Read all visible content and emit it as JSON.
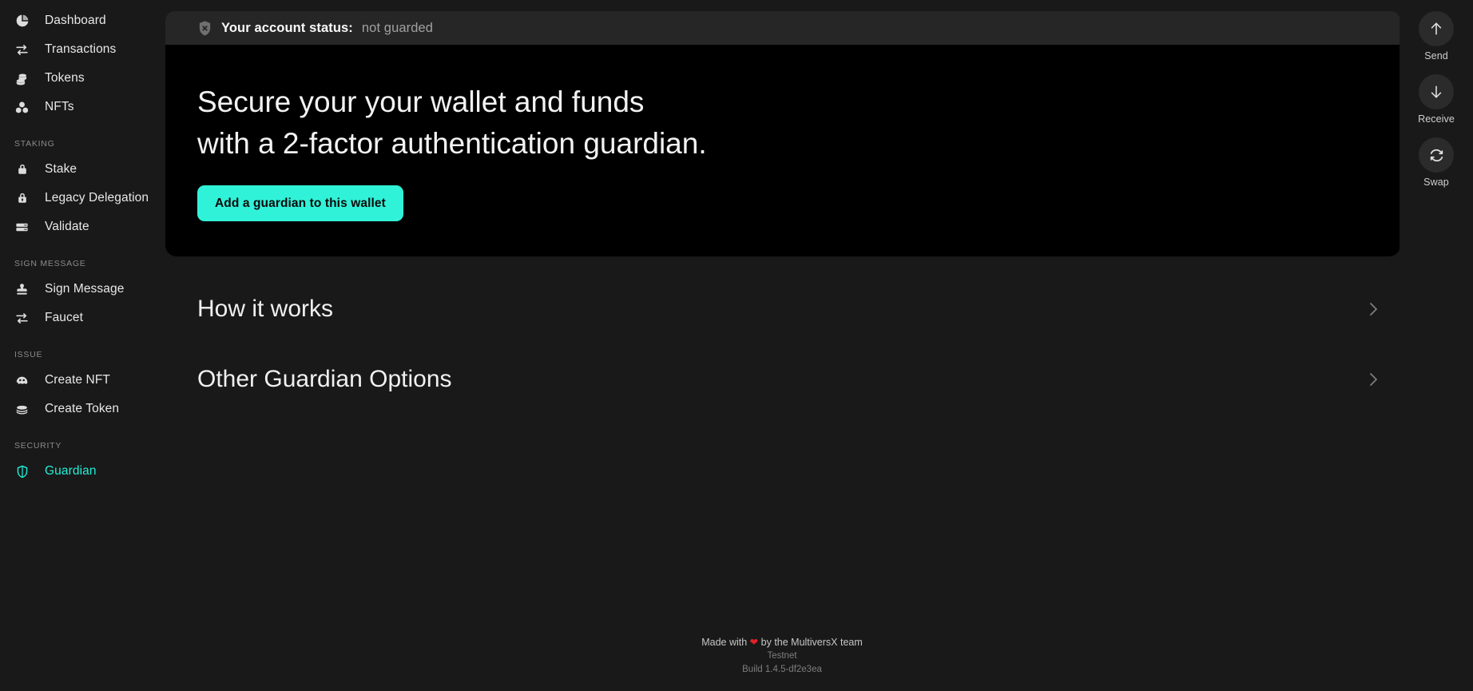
{
  "colors": {
    "page_bg": "#19191a",
    "panel_bg": "#262626",
    "hero_bg": "#000000",
    "accent_teal": "#30f2d8",
    "active_nav": "#23f0d6",
    "heart_red": "#e32228"
  },
  "sidebar": {
    "items": [
      {
        "label": "Dashboard",
        "icon": "pie-chart-icon",
        "active": false
      },
      {
        "label": "Transactions",
        "icon": "exchange-icon",
        "active": false
      },
      {
        "label": "Tokens",
        "icon": "coins-icon",
        "active": false
      },
      {
        "label": "NFTs",
        "icon": "nft-cluster-icon",
        "active": false
      }
    ],
    "groups": [
      {
        "title": "STAKING",
        "items": [
          {
            "label": "Stake",
            "icon": "lock-icon",
            "active": false
          },
          {
            "label": "Legacy Delegation",
            "icon": "lock-closed-icon",
            "active": false
          },
          {
            "label": "Validate",
            "icon": "server-rack-icon",
            "active": false
          }
        ]
      },
      {
        "title": "SIGN MESSAGE",
        "items": [
          {
            "label": "Sign Message",
            "icon": "stamp-icon",
            "active": false
          },
          {
            "label": "Faucet",
            "icon": "exchange-icon",
            "active": false
          }
        ]
      },
      {
        "title": "ISSUE",
        "items": [
          {
            "label": "Create NFT",
            "icon": "nft-create-icon",
            "active": false
          },
          {
            "label": "Create Token",
            "icon": "coin-stack-icon",
            "active": false
          }
        ]
      },
      {
        "title": "SECURITY",
        "items": [
          {
            "label": "Guardian",
            "icon": "shield-outline-icon",
            "active": true
          }
        ]
      }
    ]
  },
  "status": {
    "icon": "shield-x-icon",
    "label": "Your account status:",
    "value": "not guarded"
  },
  "hero": {
    "heading_line1": "Secure your your wallet and funds",
    "heading_line2": "with a 2-factor authentication guardian.",
    "cta_label": "Add a guardian to this wallet"
  },
  "accordion": {
    "rows": [
      {
        "title": "How it works",
        "chevron": "chevron-right-icon"
      },
      {
        "title": "Other Guardian Options",
        "chevron": "chevron-right-icon"
      }
    ]
  },
  "rail": {
    "actions": [
      {
        "label": "Send",
        "icon": "arrow-up-icon"
      },
      {
        "label": "Receive",
        "icon": "arrow-down-icon"
      },
      {
        "label": "Swap",
        "icon": "swap-refresh-icon"
      }
    ]
  },
  "footer": {
    "made_prefix": "Made with",
    "heart": "❤",
    "made_suffix": "by the MultiversX team",
    "network": "Testnet",
    "build": "Build 1.4.5-df2e3ea"
  }
}
